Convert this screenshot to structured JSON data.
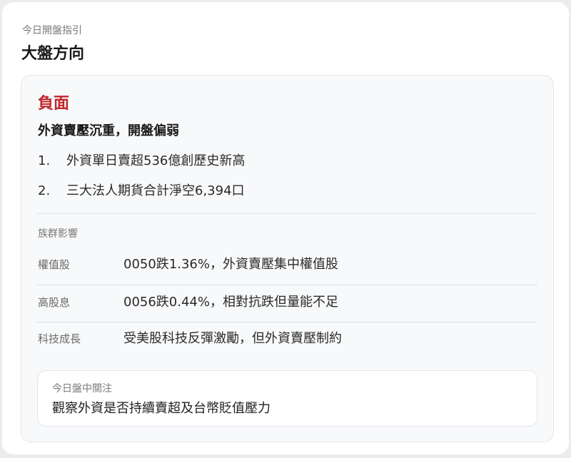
{
  "header": {
    "subtitle": "今日開盤指引",
    "title": "大盤方向"
  },
  "outlook": {
    "sentiment": "負面",
    "sentiment_color": "#c0272d",
    "headline": "外資賣壓沉重，開盤偏弱",
    "points": [
      {
        "num": "1.",
        "text": "外資單日賣超536億創歷史新高"
      },
      {
        "num": "2.",
        "text": "三大法人期貨合計淨空6,394口"
      }
    ]
  },
  "sectors": {
    "label": "族群影響",
    "rows": [
      {
        "name": "權值股",
        "desc": "0050跌1.36%，外資賣壓集中權值股"
      },
      {
        "name": "高股息",
        "desc": "0056跌0.44%，相對抗跌但量能不足"
      },
      {
        "name": "科技成長",
        "desc": "受美股科技反彈激勵，但外資賣壓制約"
      }
    ]
  },
  "focus": {
    "label": "今日盤中關注",
    "text": "觀察外資是否持續賣超及台幣貶值壓力"
  }
}
